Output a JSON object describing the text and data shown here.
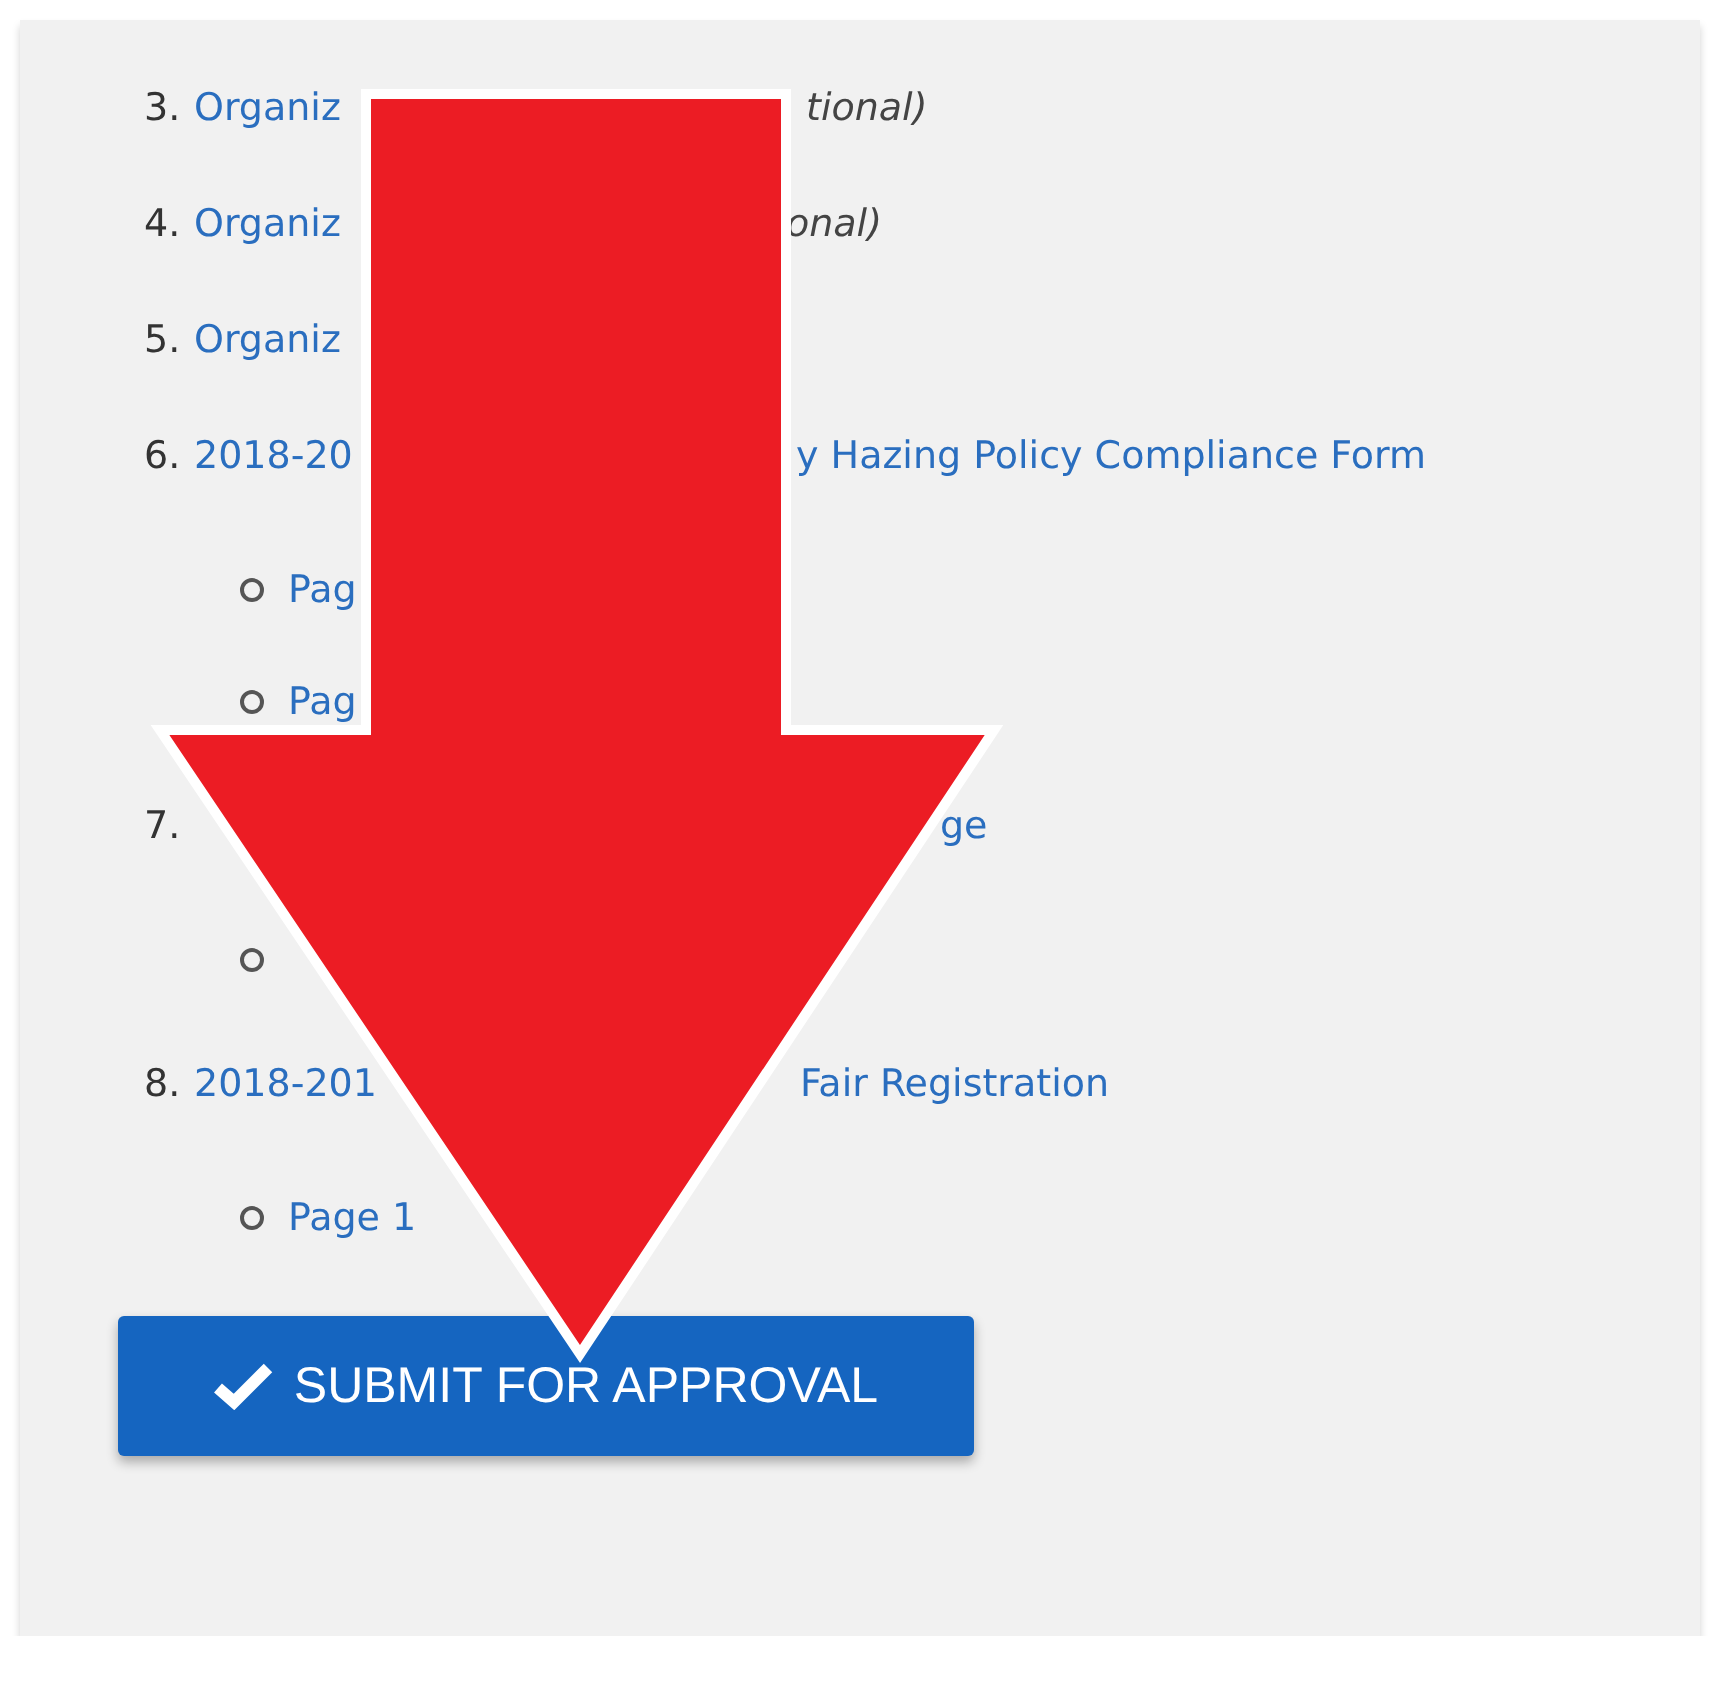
{
  "items": [
    {
      "number": "3.",
      "left": {
        "text": "Organiz",
        "kind": "link"
      },
      "right": {
        "text": "tional)",
        "kind": "note"
      }
    },
    {
      "number": "4.",
      "left": {
        "text": "Organiz",
        "kind": "link"
      },
      "right": {
        "text": "onal)",
        "kind": "note"
      }
    },
    {
      "number": "5.",
      "left": {
        "text": "Organiz",
        "kind": "link"
      }
    },
    {
      "number": "6.",
      "left": {
        "text": "2018-20",
        "kind": "link"
      },
      "right": {
        "text": "y Hazing Policy Compliance Form",
        "kind": "link"
      },
      "children": [
        {
          "kind": "link",
          "text": "Pag"
        },
        {
          "kind": "link",
          "text": "Pag"
        }
      ]
    },
    {
      "number": "7.",
      "right": {
        "text": "ge",
        "kind": "link"
      },
      "children": [
        {
          "kind": "covered"
        }
      ]
    },
    {
      "number": "8.",
      "left": {
        "text": "2018-201",
        "kind": "link"
      },
      "right": {
        "text": "Fair Registration",
        "kind": "link"
      },
      "children": [
        {
          "kind": "link",
          "text": "Page 1"
        }
      ]
    }
  ],
  "submit_button": {
    "label": "SUBMIT FOR APPROVAL"
  }
}
